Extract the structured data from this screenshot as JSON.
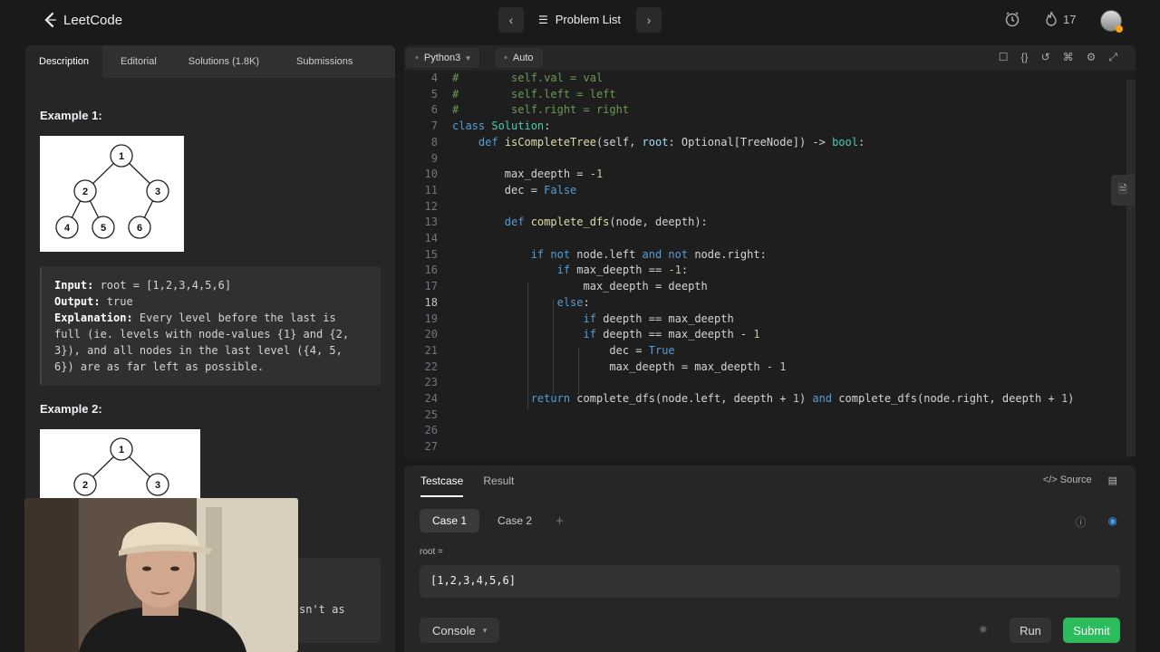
{
  "topbar": {
    "logo_text": "LeetCode",
    "problem_list_label": "Problem List",
    "streak_count": "17"
  },
  "left_tabs": [
    "Description",
    "Editorial",
    "Solutions (1.8K)",
    "Submissions"
  ],
  "example1": {
    "title": "Example 1:",
    "tree_nodes": [
      "1",
      "2",
      "3",
      "4",
      "5",
      "6"
    ],
    "input_label": "Input:",
    "input_value": " root = [1,2,3,4,5,6]",
    "output_label": "Output:",
    "output_value": " true",
    "explanation_label": "Explanation:",
    "explanation_line1": " Every level before the last is",
    "explanation_line2": "full (ie. levels with node-values {1} and {2,",
    "explanation_line3": "3}), and all nodes in the last level ({4, 5,",
    "explanation_line4": "6}) are as far left as possible."
  },
  "example2": {
    "title": "Example 2:",
    "tree_nodes": [
      "1",
      "2",
      "3"
    ],
    "partial_text": "sn't as"
  },
  "editor": {
    "language": "Python3",
    "mode": "Auto",
    "current_line": 18,
    "lines": [
      {
        "n": "4",
        "tokens": [
          [
            "cm",
            "#        self.val = val"
          ]
        ]
      },
      {
        "n": "5",
        "tokens": [
          [
            "cm",
            "#        self.left = left"
          ]
        ]
      },
      {
        "n": "6",
        "tokens": [
          [
            "cm",
            "#        self.right = right"
          ]
        ]
      },
      {
        "n": "7",
        "tokens": [
          [
            "kw",
            "class "
          ],
          [
            "cls",
            "Solution"
          ],
          [
            "",
            ":"
          ]
        ]
      },
      {
        "n": "8",
        "tokens": [
          [
            "",
            "    "
          ],
          [
            "kw",
            "def "
          ],
          [
            "fn",
            "isCompleteTree"
          ],
          [
            "",
            "(self, "
          ],
          [
            "pm",
            "root"
          ],
          [
            "",
            ": Optional[TreeNode]) -> "
          ],
          [
            "cls",
            "bool"
          ],
          [
            "",
            ":"
          ]
        ]
      },
      {
        "n": "9",
        "tokens": []
      },
      {
        "n": "10",
        "tokens": [
          [
            "",
            "        max_deepth = "
          ],
          [
            "num",
            "-1"
          ]
        ]
      },
      {
        "n": "11",
        "tokens": [
          [
            "",
            "        dec = "
          ],
          [
            "kw",
            "False"
          ]
        ]
      },
      {
        "n": "12",
        "tokens": []
      },
      {
        "n": "13",
        "tokens": [
          [
            "",
            "        "
          ],
          [
            "kw",
            "def "
          ],
          [
            "fn",
            "complete_dfs"
          ],
          [
            "",
            "(node, deepth):"
          ]
        ]
      },
      {
        "n": "14",
        "tokens": []
      },
      {
        "n": "15",
        "tokens": [
          [
            "",
            "            "
          ],
          [
            "kw",
            "if not "
          ],
          [
            "",
            "node.left "
          ],
          [
            "kw",
            "and not "
          ],
          [
            "",
            "node.right:"
          ]
        ]
      },
      {
        "n": "16",
        "tokens": [
          [
            "",
            "                "
          ],
          [
            "kw",
            "if "
          ],
          [
            "",
            "max_deepth == "
          ],
          [
            "num",
            "-1"
          ],
          [
            "",
            ":"
          ]
        ]
      },
      {
        "n": "17",
        "tokens": [
          [
            "",
            "                    max_deepth = deepth"
          ]
        ]
      },
      {
        "n": "18",
        "tokens": [
          [
            "",
            "                "
          ],
          [
            "kw",
            "else"
          ],
          [
            "",
            ":"
          ]
        ]
      },
      {
        "n": "19",
        "tokens": [
          [
            "",
            "                    "
          ],
          [
            "kw",
            "if "
          ],
          [
            "",
            "deepth == max_deepth"
          ]
        ]
      },
      {
        "n": "20",
        "tokens": [
          [
            "",
            "                    "
          ],
          [
            "kw",
            "if "
          ],
          [
            "",
            "deepth == max_deepth - "
          ],
          [
            "num",
            "1"
          ]
        ]
      },
      {
        "n": "21",
        "tokens": [
          [
            "",
            "                        dec = "
          ],
          [
            "kw",
            "True"
          ]
        ]
      },
      {
        "n": "22",
        "tokens": [
          [
            "",
            "                        max_deepth = max_deepth - "
          ],
          [
            "num",
            "1"
          ]
        ]
      },
      {
        "n": "23",
        "tokens": []
      },
      {
        "n": "24",
        "tokens": [
          [
            "",
            "            "
          ],
          [
            "kw",
            "return "
          ],
          [
            "",
            "complete_dfs(node.left, deepth + "
          ],
          [
            "num",
            "1"
          ],
          [
            "",
            ") "
          ],
          [
            "kw",
            "and "
          ],
          [
            "",
            "complete_dfs(node.right, deepth + "
          ],
          [
            "num",
            "1"
          ],
          [
            "",
            ")"
          ]
        ]
      },
      {
        "n": "25",
        "tokens": []
      },
      {
        "n": "26",
        "tokens": []
      },
      {
        "n": "27",
        "tokens": []
      }
    ]
  },
  "bottom": {
    "tab_testcase": "Testcase",
    "tab_result": "Result",
    "source_label": "Source",
    "case1": "Case 1",
    "case2": "Case 2",
    "root_label": "root =",
    "root_value": "[1,2,3,4,5,6]",
    "console_label": "Console",
    "run_label": "Run",
    "submit_label": "Submit"
  },
  "colors": {
    "accent_orange": "#ffa116",
    "submit_green": "#2cbb5d",
    "keyword_blue": "#569cd6"
  }
}
